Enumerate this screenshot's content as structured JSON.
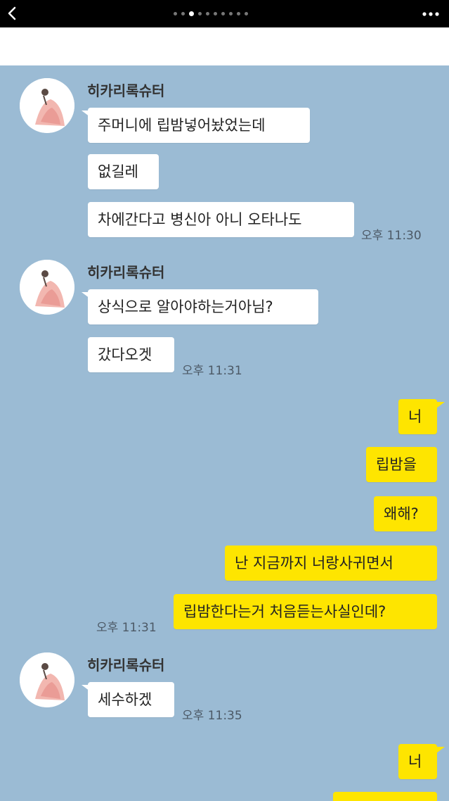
{
  "colors": {
    "chat_background": "#9bbbd4",
    "incoming_bubble": "#ffffff",
    "outgoing_bubble": "#fee500",
    "top_bar": "#000000"
  },
  "top_bar": {
    "back_icon": "chevron-left-icon",
    "more_icon": "more-horizontal-icon",
    "page_count": 10,
    "active_page": 3
  },
  "groups": [
    {
      "sender": "히카리록슈터",
      "messages": [
        "주머니에 립밤넣어놨었는데",
        "없길레",
        "차에간다고 병신아 아니 오타나도"
      ],
      "time": "오후 11:30"
    },
    {
      "sender": "히카리록슈터",
      "messages": [
        "상식으로 알아야하는거아님?",
        "갔다오겟"
      ],
      "time": "오후 11:31"
    },
    {
      "messages": [
        "너",
        "립밤을",
        "왜해?",
        "난 지금까지 너랑사귀면서",
        "립밤한다는거 처음듣는사실인데?"
      ],
      "time": "오후 11:31"
    },
    {
      "sender": "히카리록슈터",
      "messages": [
        "세수하겠"
      ],
      "time": "오후 11:35"
    },
    {
      "messages": [
        "너"
      ]
    }
  ]
}
